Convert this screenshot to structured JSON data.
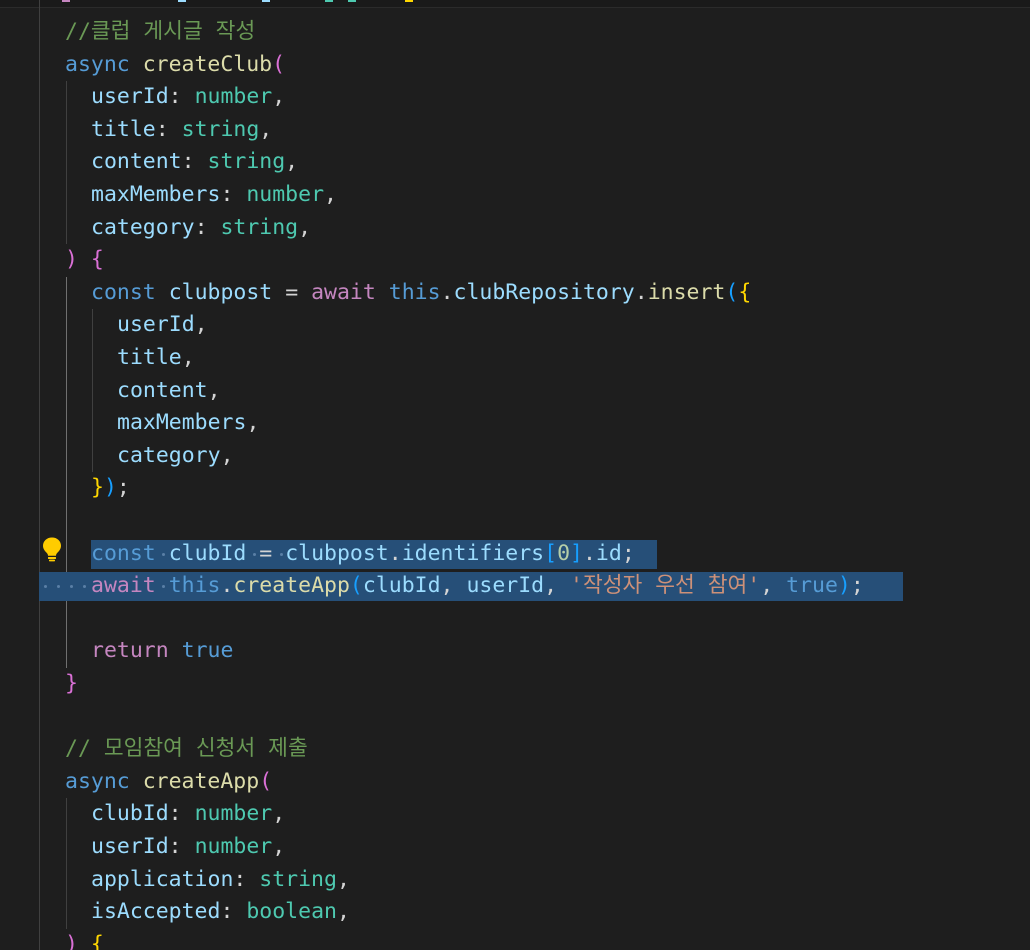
{
  "editor": {
    "theme": "dark",
    "colors": {
      "background": "#1e1e1e",
      "selection": "#264f78",
      "keyword": "#569cd6",
      "control_keyword": "#c586c0",
      "function": "#dcdcaa",
      "variable": "#9cdcfe",
      "type": "#4ec9b0",
      "string": "#ce9178",
      "number": "#b5cea8",
      "comment": "#6a9955",
      "bracket_level_1": "#ffd700",
      "bracket_level_2": "#da70d6",
      "bracket_level_3": "#179fff"
    },
    "lightbulb_icon": "lightbulb-icon",
    "lines": [
      {
        "name": "code-line-comment-club-post",
        "tokens": [
          [
            "cm",
            "//클럽 게시글 작성"
          ]
        ]
      },
      {
        "name": "code-line-createclub-signature",
        "tokens": [
          [
            "k",
            "async"
          ],
          [
            "p",
            " "
          ],
          [
            "f",
            "createClub"
          ],
          [
            "b2",
            "("
          ]
        ]
      },
      {
        "name": "code-line-param-userid",
        "tokens": [
          [
            "v",
            "userId"
          ],
          [
            "p",
            ": "
          ],
          [
            "t",
            "number"
          ],
          [
            "p",
            ","
          ]
        ]
      },
      {
        "name": "code-line-param-title",
        "tokens": [
          [
            "v",
            "title"
          ],
          [
            "p",
            ": "
          ],
          [
            "t",
            "string"
          ],
          [
            "p",
            ","
          ]
        ]
      },
      {
        "name": "code-line-param-content",
        "tokens": [
          [
            "v",
            "content"
          ],
          [
            "p",
            ": "
          ],
          [
            "t",
            "string"
          ],
          [
            "p",
            ","
          ]
        ]
      },
      {
        "name": "code-line-param-maxmembers",
        "tokens": [
          [
            "v",
            "maxMembers"
          ],
          [
            "p",
            ": "
          ],
          [
            "t",
            "number"
          ],
          [
            "p",
            ","
          ]
        ]
      },
      {
        "name": "code-line-param-category",
        "tokens": [
          [
            "v",
            "category"
          ],
          [
            "p",
            ": "
          ],
          [
            "t",
            "string"
          ],
          [
            "p",
            ","
          ]
        ]
      },
      {
        "name": "code-line-createclub-body-open",
        "tokens": [
          [
            "b2",
            ")"
          ],
          [
            "p",
            " "
          ],
          [
            "b2",
            "{"
          ]
        ]
      },
      {
        "name": "code-line-insert-call",
        "tokens": [
          [
            "k",
            "const"
          ],
          [
            "p",
            " "
          ],
          [
            "v",
            "clubpost"
          ],
          [
            "p",
            " = "
          ],
          [
            "c",
            "await"
          ],
          [
            "p",
            " "
          ],
          [
            "k",
            "this"
          ],
          [
            "p",
            "."
          ],
          [
            "v",
            "clubRepository"
          ],
          [
            "p",
            "."
          ],
          [
            "f",
            "insert"
          ],
          [
            "b3",
            "("
          ],
          [
            "b1",
            "{"
          ]
        ]
      },
      {
        "name": "code-line-insert-userid",
        "tokens": [
          [
            "v",
            "userId"
          ],
          [
            "p",
            ","
          ]
        ]
      },
      {
        "name": "code-line-insert-title",
        "tokens": [
          [
            "v",
            "title"
          ],
          [
            "p",
            ","
          ]
        ]
      },
      {
        "name": "code-line-insert-content",
        "tokens": [
          [
            "v",
            "content"
          ],
          [
            "p",
            ","
          ]
        ]
      },
      {
        "name": "code-line-insert-maxmembers",
        "tokens": [
          [
            "v",
            "maxMembers"
          ],
          [
            "p",
            ","
          ]
        ]
      },
      {
        "name": "code-line-insert-category",
        "tokens": [
          [
            "v",
            "category"
          ],
          [
            "p",
            ","
          ]
        ]
      },
      {
        "name": "code-line-insert-close",
        "tokens": [
          [
            "b1",
            "}"
          ],
          [
            "b3",
            ")"
          ],
          [
            "p",
            ";"
          ]
        ]
      },
      {
        "name": "code-line-blank-1",
        "tokens": []
      },
      {
        "name": "code-line-const-clubid",
        "tokens": [
          [
            "k",
            "const"
          ],
          [
            "p",
            " "
          ],
          [
            "v",
            "clubId"
          ],
          [
            "p",
            " = "
          ],
          [
            "v",
            "clubpost"
          ],
          [
            "p",
            "."
          ],
          [
            "v",
            "identifiers"
          ],
          [
            "b3",
            "["
          ],
          [
            "n",
            "0"
          ],
          [
            "b3",
            "]"
          ],
          [
            "p",
            "."
          ],
          [
            "v",
            "id"
          ],
          [
            "p",
            ";"
          ]
        ]
      },
      {
        "name": "code-line-await-createapp",
        "tokens": [
          [
            "c",
            "await"
          ],
          [
            "p",
            " "
          ],
          [
            "k",
            "this"
          ],
          [
            "p",
            "."
          ],
          [
            "f",
            "createApp"
          ],
          [
            "b3",
            "("
          ],
          [
            "v",
            "clubId"
          ],
          [
            "p",
            ", "
          ],
          [
            "v",
            "userId"
          ],
          [
            "p",
            ", "
          ],
          [
            "s",
            "'작성자 우선 참여'"
          ],
          [
            "p",
            ", "
          ],
          [
            "k",
            "true"
          ],
          [
            "b3",
            ")"
          ],
          [
            "p",
            ";"
          ]
        ]
      },
      {
        "name": "code-line-blank-2",
        "tokens": []
      },
      {
        "name": "code-line-return-true",
        "tokens": [
          [
            "c",
            "return"
          ],
          [
            "p",
            " "
          ],
          [
            "k",
            "true"
          ]
        ]
      },
      {
        "name": "code-line-createclub-close",
        "tokens": [
          [
            "b2",
            "}"
          ]
        ]
      },
      {
        "name": "code-line-blank-3",
        "tokens": []
      },
      {
        "name": "code-line-comment-application",
        "tokens": [
          [
            "cm",
            "// 모임참여 신청서 제출"
          ]
        ]
      },
      {
        "name": "code-line-createapp-signature",
        "tokens": [
          [
            "k",
            "async"
          ],
          [
            "p",
            " "
          ],
          [
            "f",
            "createApp"
          ],
          [
            "b2",
            "("
          ]
        ]
      },
      {
        "name": "code-line-param-clubid",
        "tokens": [
          [
            "v",
            "clubId"
          ],
          [
            "p",
            ": "
          ],
          [
            "t",
            "number"
          ],
          [
            "p",
            ","
          ]
        ]
      },
      {
        "name": "code-line-param-userid-2",
        "tokens": [
          [
            "v",
            "userId"
          ],
          [
            "p",
            ": "
          ],
          [
            "t",
            "number"
          ],
          [
            "p",
            ","
          ]
        ]
      },
      {
        "name": "code-line-param-application",
        "tokens": [
          [
            "v",
            "application"
          ],
          [
            "p",
            ": "
          ],
          [
            "t",
            "string"
          ],
          [
            "p",
            ","
          ]
        ]
      },
      {
        "name": "code-line-param-isaccepted",
        "tokens": [
          [
            "v",
            "isAccepted"
          ],
          [
            "p",
            ": "
          ],
          [
            "t",
            "boolean"
          ],
          [
            "p",
            ","
          ]
        ]
      },
      {
        "name": "code-line-createapp-body-open",
        "tokens": [
          [
            "b2",
            ")"
          ],
          [
            "p",
            " "
          ],
          [
            "b1",
            "{"
          ]
        ]
      }
    ]
  }
}
